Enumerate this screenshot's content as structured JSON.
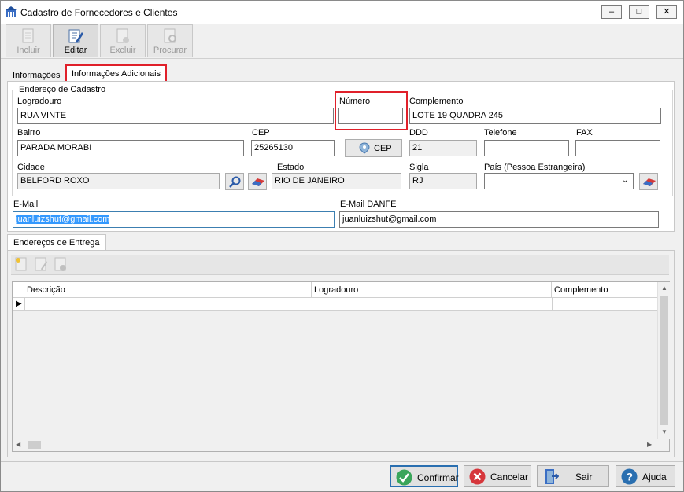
{
  "window": {
    "title": "Cadastro de Fornecedores e Clientes"
  },
  "toolbar": {
    "incluir": "Incluir",
    "editar": "Editar",
    "excluir": "Excluir",
    "procurar": "Procurar"
  },
  "tabs": [
    {
      "label": "Informações"
    },
    {
      "label": "Informações Adicionais"
    }
  ],
  "endereco": {
    "group": "Endereço de Cadastro",
    "logradouro_label": "Logradouro",
    "logradouro": "RUA VINTE",
    "numero_label": "Número",
    "numero": "",
    "complemento_label": "Complemento",
    "complemento": "LOTE 19 QUADRA 245",
    "bairro_label": "Bairro",
    "bairro": "PARADA MORABI",
    "cep_label": "CEP",
    "cep": "25265130",
    "cep_button": "CEP",
    "ddd_label": "DDD",
    "ddd": "21",
    "telefone_label": "Telefone",
    "telefone": "",
    "fax_label": "FAX",
    "fax": "",
    "cidade_label": "Cidade",
    "cidade": "BELFORD ROXO",
    "estado_label": "Estado",
    "estado": "RIO DE JANEIRO",
    "sigla_label": "Sigla",
    "sigla": "RJ",
    "pais_label": "País (Pessoa Estrangeira)",
    "pais": ""
  },
  "email": {
    "email_label": "E-Mail",
    "email": "juanluizshut@gmail.com",
    "danfe_label": "E-Mail DANFE",
    "danfe": "juanluizshut@gmail.com"
  },
  "entrega": {
    "tab": "Endereços de Entrega",
    "columns": [
      "Descrição",
      "Logradouro",
      "Complemento"
    ]
  },
  "footer": {
    "confirmar": "Confirmar",
    "cancelar": "Cancelar",
    "sair": "Sair",
    "ajuda": "Ajuda"
  }
}
